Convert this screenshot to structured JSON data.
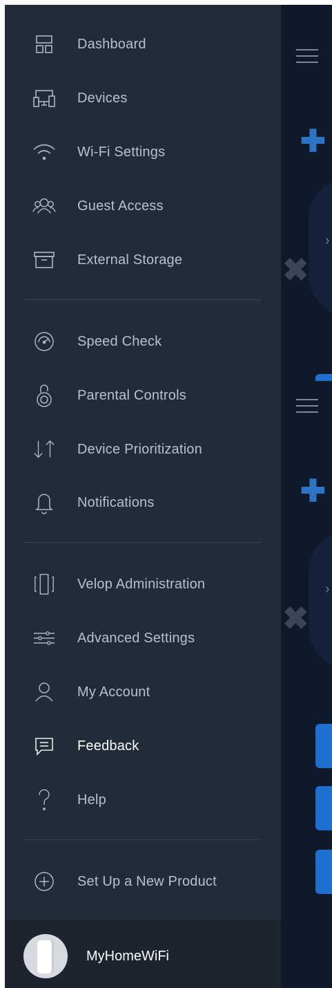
{
  "menu": {
    "section1": [
      {
        "label": "Dashboard",
        "icon": "dashboard-icon"
      },
      {
        "label": "Devices",
        "icon": "devices-icon"
      },
      {
        "label": "Wi-Fi Settings",
        "icon": "wifi-icon"
      },
      {
        "label": "Guest Access",
        "icon": "guest-access-icon"
      },
      {
        "label": "External Storage",
        "icon": "external-storage-icon"
      }
    ],
    "section2": [
      {
        "label": "Speed Check",
        "icon": "speedometer-icon"
      },
      {
        "label": "Parental Controls",
        "icon": "lock-icon"
      },
      {
        "label": "Device Prioritization",
        "icon": "priority-arrows-icon"
      },
      {
        "label": "Notifications",
        "icon": "bell-icon"
      }
    ],
    "section3": [
      {
        "label": "Velop Administration",
        "icon": "velop-node-icon"
      },
      {
        "label": "Advanced Settings",
        "icon": "sliders-icon"
      },
      {
        "label": "My Account",
        "icon": "user-icon"
      },
      {
        "label": "Feedback",
        "icon": "chat-bubble-icon",
        "active": true
      },
      {
        "label": "Help",
        "icon": "question-icon"
      }
    ],
    "section4": [
      {
        "label": "Set Up a New Product",
        "icon": "add-circle-icon"
      }
    ]
  },
  "footer": {
    "network_name": "MyHomeWiFi",
    "avatar_icon": "velop-node-avatar"
  },
  "colors": {
    "drawer_bg": "#222b38",
    "footer_bg": "#1c2430",
    "label": "#b8c0cb",
    "label_active": "#ffffff",
    "accent": "#1f6fd1"
  }
}
